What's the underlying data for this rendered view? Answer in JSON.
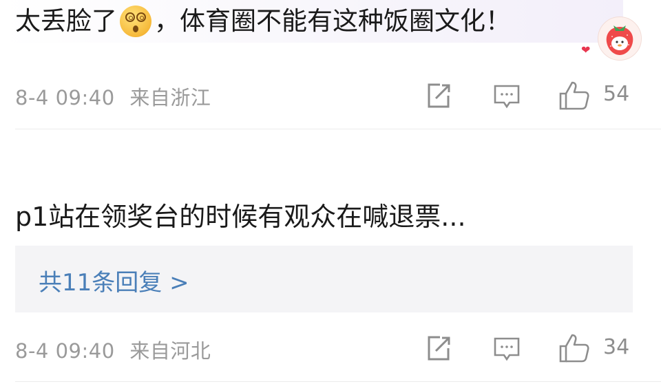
{
  "comments": [
    {
      "text_before_emoji": "太丢脸了",
      "emoji": "dizzy-face-emoji",
      "text_after_emoji": "，体育圈不能有这种饭圈文化！",
      "date": "8-4 09:40",
      "location": "来自浙江",
      "likes": "54"
    },
    {
      "text": "p1站在领奖台的时候有观众在喊退票...",
      "replies_label": "共11条回复 >",
      "date": "8-4 09:40",
      "location": "来自河北",
      "likes": "34"
    }
  ],
  "icons": {
    "share": "share-icon",
    "comment": "comment-icon",
    "like": "thumbs-up-icon",
    "avatar": "strawberry-avatar",
    "heart": "heart-badge-icon"
  },
  "colors": {
    "link": "#4a7fb8",
    "meta": "#9a9a9a",
    "heart": "#e8364f"
  }
}
